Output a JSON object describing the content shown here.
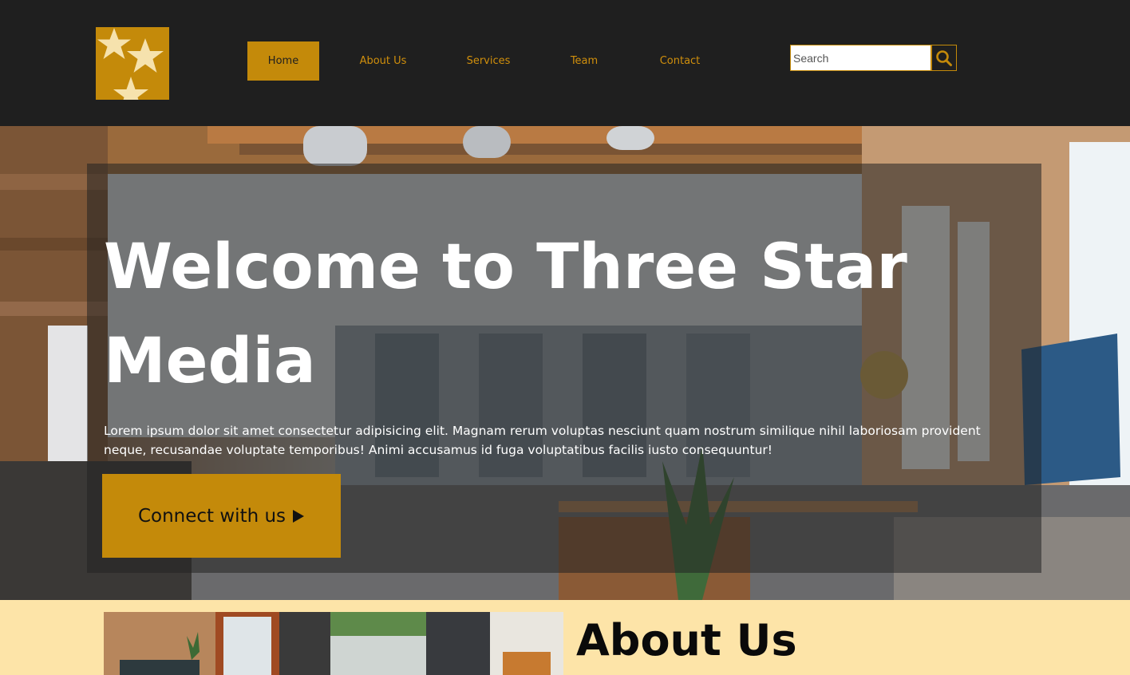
{
  "brand": {
    "logo_icon": "three-stars-logo",
    "accent_color": "#c48a0a",
    "header_bg": "#1f1f1f",
    "about_bg": "#fde4a8"
  },
  "nav": {
    "items": [
      {
        "label": "Home",
        "active": true
      },
      {
        "label": "About Us",
        "active": false
      },
      {
        "label": "Services",
        "active": false
      },
      {
        "label": "Team",
        "active": false
      },
      {
        "label": "Contact",
        "active": false
      }
    ]
  },
  "search": {
    "placeholder": "Search",
    "value": "",
    "icon": "search-icon"
  },
  "hero": {
    "title": "Welcome to Three Star Media",
    "text": "Lorem ipsum dolor sit amet consectetur adipisicing elit. Magnam rerum voluptas nesciunt quam nostrum similique nihil laboriosam provident neque, recusandae voluptate temporibus! Animi accusamus id fuga voluptatibus facilis iusto consequuntur!",
    "cta_label": "Connect with us",
    "cta_icon": "play-arrow-icon"
  },
  "about": {
    "title": "About Us"
  }
}
